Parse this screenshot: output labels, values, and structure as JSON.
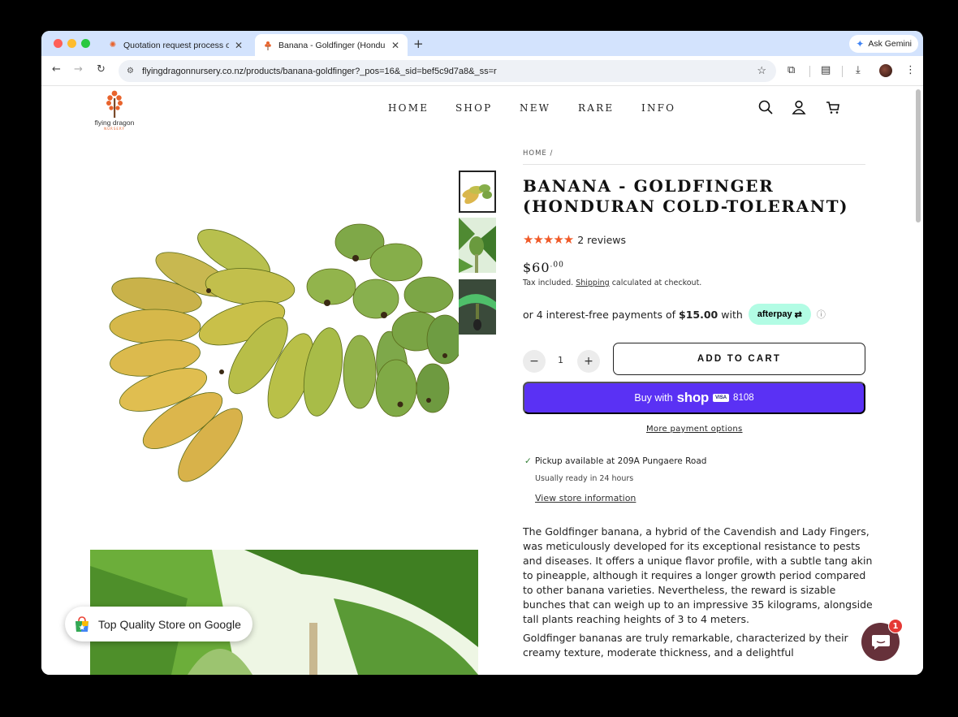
{
  "browser": {
    "tabs": [
      {
        "title": "Quotation request process ou",
        "favicon": "flower-favicon"
      },
      {
        "title": "Banana - Goldfinger (Hondura",
        "favicon": "nursery-favicon"
      }
    ],
    "new_tab": "+",
    "ask_gemini": "Ask Gemini",
    "url": "flyingdragonnursery.co.nz/products/banana-goldfinger?_pos=16&_sid=bef5c9d7a8&_ss=r"
  },
  "site": {
    "logo_text": "flying dragon",
    "logo_sub": "NURSERY",
    "nav": [
      "HOME",
      "SHOP",
      "NEW",
      "RARE",
      "INFO"
    ]
  },
  "product": {
    "breadcrumb": "HOME /",
    "title_line1": "BANANA - GOLDFINGER",
    "title_line2": "(HONDURAN COLD-TOLERANT)",
    "stars": "★★★★★",
    "rating": 5,
    "reviews": "2 reviews",
    "price_main": "$60",
    "price_cents": ".00",
    "tax_prefix": "Tax included.",
    "shipping_link": "Shipping",
    "tax_suffix": "calculated at checkout.",
    "installment_prefix": "or 4 interest-free payments of",
    "installment_amount": "$15.00",
    "installment_with": "with",
    "afterpay": "afterpay",
    "quantity": "1",
    "minus": "−",
    "plus": "+",
    "add_to_cart": "ADD TO CART",
    "buy_with": "Buy with",
    "shop_logo": "shop",
    "card_brand": "VISA",
    "card_last4": "8108",
    "more_payment": "More payment options",
    "pickup_label": "Pickup available at 209A Pungaere Road",
    "ready_label": "Usually ready in 24 hours",
    "store_info": "View store information",
    "description": [
      "The Goldfinger banana, a hybrid of the Cavendish and Lady Fingers, was meticulously developed for its exceptional resistance to pests and diseases. It offers a unique flavor profile, with a subtle tang akin to pineapple, although it requires a longer growth period compared to other banana varieties. Nevertheless, the reward is sizable bunches that can weigh up to an impressive 35 kilograms, alongside tall plants reaching heights of 3 to 4 meters.",
      "Goldfinger bananas are truly remarkable, characterized by their creamy texture, moderate thickness, and a delightful"
    ]
  },
  "badge": {
    "label": "Top Quality Store on Google"
  },
  "chat": {
    "count": "1"
  },
  "colors": {
    "accent": "#5a31f4",
    "stars": "#f05a28",
    "afterpay": "#b2fce4",
    "chat": "#66313a"
  }
}
